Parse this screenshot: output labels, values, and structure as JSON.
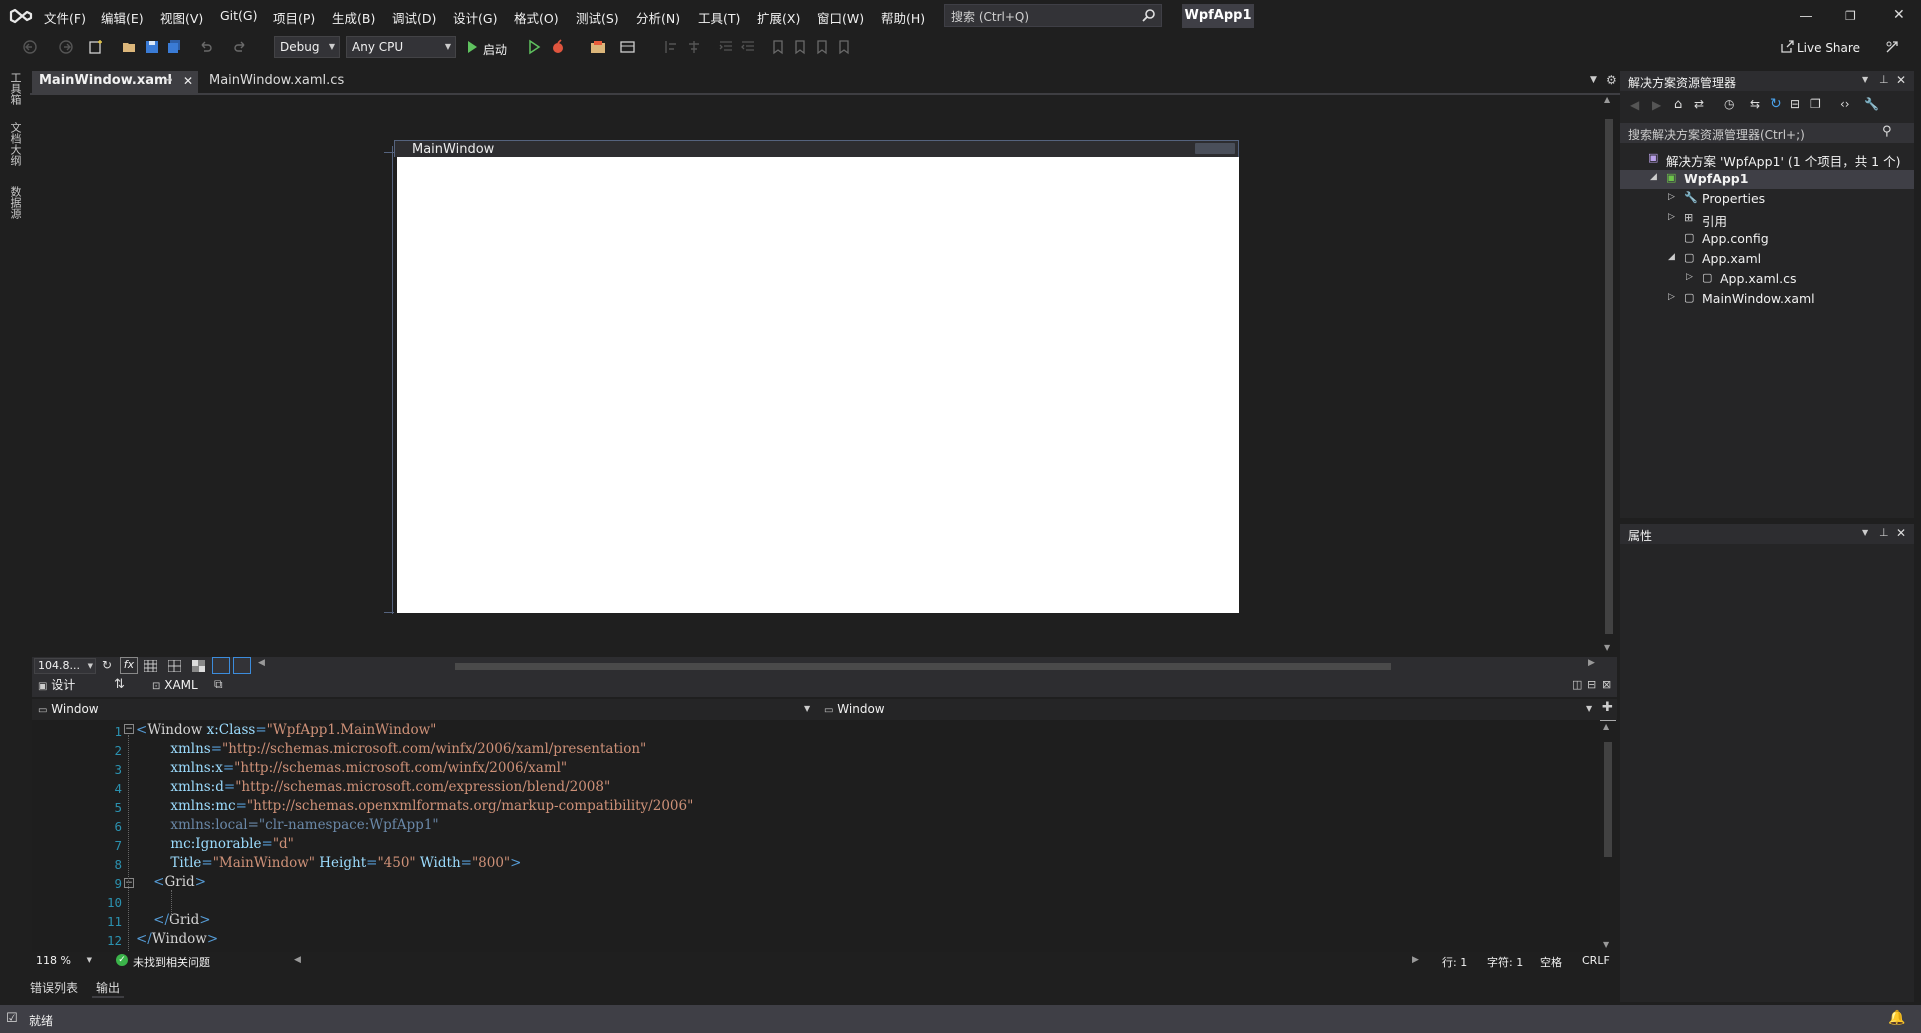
{
  "menu": {
    "items": [
      "文件(F)",
      "编辑(E)",
      "视图(V)",
      "Git(G)",
      "项目(P)",
      "生成(B)",
      "调试(D)",
      "设计(G)",
      "格式(O)",
      "测试(S)",
      "分析(N)",
      "工具(T)",
      "扩展(X)",
      "窗口(W)",
      "帮助(H)"
    ],
    "search_placeholder": "搜索 (Ctrl+Q)",
    "app_name": "WpfApp1"
  },
  "toolbar": {
    "config": "Debug",
    "platform": "Any CPU",
    "start_label": "启动",
    "live_share": "Live Share"
  },
  "left_strip": [
    "工具箱",
    "文档大纲",
    "数据源"
  ],
  "doc_tabs": [
    {
      "label": "MainWindow.xaml",
      "active": true
    },
    {
      "label": "MainWindow.xaml.cs",
      "active": false
    }
  ],
  "designer": {
    "window_title": "MainWindow",
    "zoom": "104.8...",
    "fx": "fx"
  },
  "split": {
    "design_label": "设计",
    "xaml_label": "XAML"
  },
  "navbar": {
    "left": "Window",
    "right": "Window"
  },
  "code_lines": [
    {
      "n": "1",
      "parts": [
        [
          "t-tag",
          "<"
        ],
        [
          "t-el",
          "Window "
        ],
        [
          "t-attr",
          "x:Class"
        ],
        [
          "t-tag",
          "="
        ],
        [
          "t-val",
          "\"WpfApp1.MainWindow\""
        ]
      ]
    },
    {
      "n": "2",
      "parts": [
        [
          "t-attr",
          "        xmlns"
        ],
        [
          "t-tag",
          "="
        ],
        [
          "t-val",
          "\"http://schemas.microsoft.com/winfx/2006/xaml/presentation\""
        ]
      ]
    },
    {
      "n": "3",
      "parts": [
        [
          "t-attr",
          "        xmlns:x"
        ],
        [
          "t-tag",
          "="
        ],
        [
          "t-val",
          "\"http://schemas.microsoft.com/winfx/2006/xaml\""
        ]
      ]
    },
    {
      "n": "4",
      "parts": [
        [
          "t-attr",
          "        xmlns:d"
        ],
        [
          "t-tag",
          "="
        ],
        [
          "t-val",
          "\"http://schemas.microsoft.com/expression/blend/2008\""
        ]
      ]
    },
    {
      "n": "5",
      "parts": [
        [
          "t-attr",
          "        xmlns:mc"
        ],
        [
          "t-tag",
          "="
        ],
        [
          "t-val",
          "\"http://schemas.openxmlformats.org/markup-compatibility/2006\""
        ]
      ]
    },
    {
      "n": "6",
      "parts": [
        [
          "t-dim",
          "        xmlns:local"
        ],
        [
          "t-dim",
          "="
        ],
        [
          "t-dim",
          "\"clr-namespace:WpfApp1\""
        ]
      ]
    },
    {
      "n": "7",
      "parts": [
        [
          "t-attr",
          "        mc:Ignorable"
        ],
        [
          "t-tag",
          "="
        ],
        [
          "t-val",
          "\"d\""
        ]
      ]
    },
    {
      "n": "8",
      "parts": [
        [
          "t-attr",
          "        Title"
        ],
        [
          "t-tag",
          "="
        ],
        [
          "t-val",
          "\"MainWindow\""
        ],
        [
          "t-attr",
          " Height"
        ],
        [
          "t-tag",
          "="
        ],
        [
          "t-val",
          "\"450\""
        ],
        [
          "t-attr",
          " Width"
        ],
        [
          "t-tag",
          "="
        ],
        [
          "t-val",
          "\"800\""
        ],
        [
          "t-tag",
          ">"
        ]
      ]
    },
    {
      "n": "9",
      "parts": [
        [
          "t-tag",
          "    <"
        ],
        [
          "t-el",
          "Grid"
        ],
        [
          "t-tag",
          ">"
        ]
      ]
    },
    {
      "n": "10",
      "parts": []
    },
    {
      "n": "11",
      "parts": [
        [
          "t-tag",
          "    </"
        ],
        [
          "t-el",
          "Grid"
        ],
        [
          "t-tag",
          ">"
        ]
      ]
    },
    {
      "n": "12",
      "parts": [
        [
          "t-tag",
          "</"
        ],
        [
          "t-el",
          "Window"
        ],
        [
          "t-tag",
          ">"
        ]
      ]
    }
  ],
  "editor_status": {
    "zoom": "118 %",
    "issues": "未找到相关问题",
    "line": "行: 1",
    "col": "字符: 1",
    "whitespace": "空格",
    "eol": "CRLF"
  },
  "bottom_tabs": [
    "错误列表",
    "输出"
  ],
  "solution_explorer": {
    "title": "解决方案资源管理器",
    "search_placeholder": "搜索解决方案资源管理器(Ctrl+;)",
    "items": [
      {
        "label": "解决方案 'WpfApp1' (1 个项目，共 1 个)",
        "level": 0,
        "expander": ""
      },
      {
        "label": "WpfApp1",
        "level": 1,
        "expander": "◢"
      },
      {
        "label": "Properties",
        "level": 2,
        "expander": "▷"
      },
      {
        "label": "引用",
        "level": 2,
        "expander": "▷"
      },
      {
        "label": "App.config",
        "level": 2,
        "expander": ""
      },
      {
        "label": "App.xaml",
        "level": 2,
        "expander": "◢"
      },
      {
        "label": "App.xaml.cs",
        "level": 3,
        "expander": "▷"
      },
      {
        "label": "MainWindow.xaml",
        "level": 2,
        "expander": "▷"
      }
    ]
  },
  "properties": {
    "title": "属性"
  },
  "statusbar": {
    "text": "就绪"
  }
}
